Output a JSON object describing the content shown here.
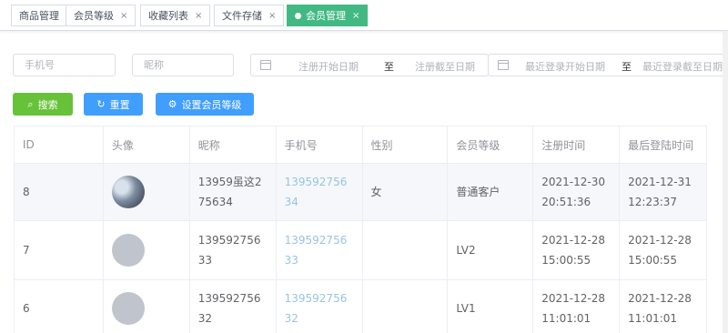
{
  "tabs": [
    {
      "label": "商品管理",
      "closable": false,
      "active": false
    },
    {
      "label": "会员等级",
      "closable": true,
      "active": false
    },
    {
      "label": "收藏列表",
      "closable": true,
      "active": false
    },
    {
      "label": "文件存储",
      "closable": true,
      "active": false
    },
    {
      "label": "会员管理",
      "closable": true,
      "active": true
    }
  ],
  "tab_close_glyph": "×",
  "filters": {
    "phone_placeholder": "手机号",
    "nickname_placeholder": "昵称",
    "register_start_placeholder": "注册开始日期",
    "register_end_placeholder": "注册截至日期",
    "login_start_placeholder": "最近登录开始日期",
    "login_end_placeholder": "最近登录截至日期",
    "range_separator": "至"
  },
  "buttons": {
    "search": "搜索",
    "reset": "重置",
    "set_level": "设置会员等级"
  },
  "table": {
    "columns": [
      "ID",
      "头像",
      "昵称",
      "手机号",
      "性别",
      "会员等级",
      "注册时间",
      "最后登陆时间"
    ],
    "rows": [
      {
        "id": "8",
        "avatar": "photo",
        "nickname": "13959虽这275634",
        "phone": "13959275634",
        "gender": "女",
        "level": "普通客户",
        "registered": "2021-12-30 20:51:36",
        "last_login": "2021-12-31 12:23:37"
      },
      {
        "id": "7",
        "avatar": "default",
        "nickname": "13959275633",
        "phone": "13959275633",
        "gender": "",
        "level": "LV2",
        "registered": "2021-12-28 15:00:55",
        "last_login": "2021-12-28 15:00:55"
      },
      {
        "id": "6",
        "avatar": "default",
        "nickname": "13959275632",
        "phone": "13959275632",
        "gender": "",
        "level": "LV1",
        "registered": "2021-12-28 11:01:01",
        "last_login": "2021-12-28 11:01:01"
      }
    ]
  },
  "colors": {
    "active_tab": "#42b983",
    "search_button": "#67c23a",
    "primary_button": "#409eff",
    "phone_link": "#99c4df"
  }
}
